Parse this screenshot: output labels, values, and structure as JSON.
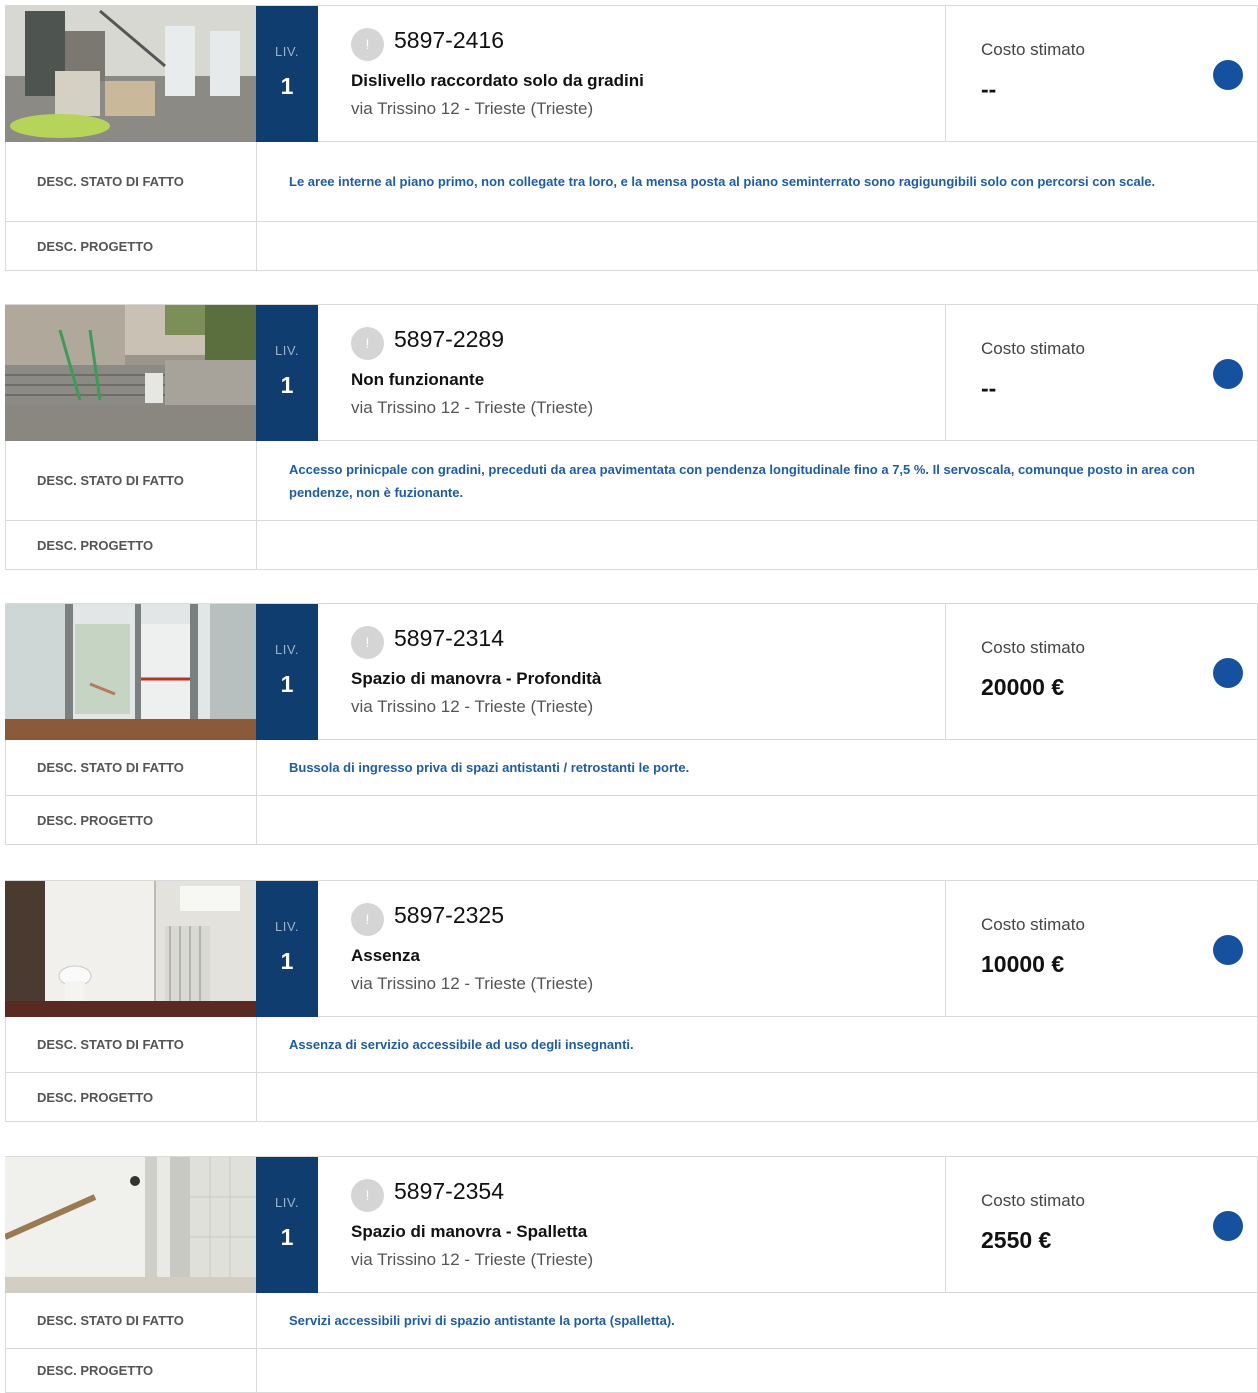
{
  "labels": {
    "level": "LIV.",
    "cost": "Costo stimato",
    "stato": "DESC. STATO DI FATTO",
    "progetto": "DESC. PROGETTO",
    "badge": "!"
  },
  "colors": {
    "level_bg": "#0f3d70",
    "dot": "#1651a0",
    "desc_text": "#1f5ca3"
  },
  "items": [
    {
      "level": "1",
      "code": "5897-2416",
      "title": "Dislivello raccordato solo da gradini",
      "address": "via Trissino 12 - Trieste (Trieste)",
      "cost": "--",
      "stato": "Le aree interne al piano primo, non collegate tra loro, e la mensa posta al piano seminterrato sono ragigungibili solo con percorsi con scale.",
      "progetto": ""
    },
    {
      "level": "1",
      "code": "5897-2289",
      "title": "Non funzionante",
      "address": "via Trissino 12 - Trieste (Trieste)",
      "cost": "--",
      "stato": "Accesso prinicpale con gradini, preceduti da area pavimentata con pendenza longitudinale fino a 7,5 %. Il servoscala, comunque posto in area con pendenze, non è fuzionante.",
      "progetto": ""
    },
    {
      "level": "1",
      "code": "5897-2314",
      "title": "Spazio di manovra - Profondità",
      "address": "via Trissino 12 - Trieste (Trieste)",
      "cost": "20000 €",
      "stato": "Bussola di ingresso priva di spazi antistanti / retrostanti le porte.",
      "progetto": ""
    },
    {
      "level": "1",
      "code": "5897-2325",
      "title": "Assenza",
      "address": "via Trissino 12 - Trieste (Trieste)",
      "cost": "10000 €",
      "stato": "Assenza di servizio accessibile ad uso degli insegnanti.",
      "progetto": ""
    },
    {
      "level": "1",
      "code": "5897-2354",
      "title": "Spazio di manovra - Spalletta",
      "address": "via Trissino 12 - Trieste (Trieste)",
      "cost": "2550 €",
      "stato": "Servizi accessibili privi di spazio antistante la porta (spalletta).",
      "progetto": ""
    }
  ]
}
